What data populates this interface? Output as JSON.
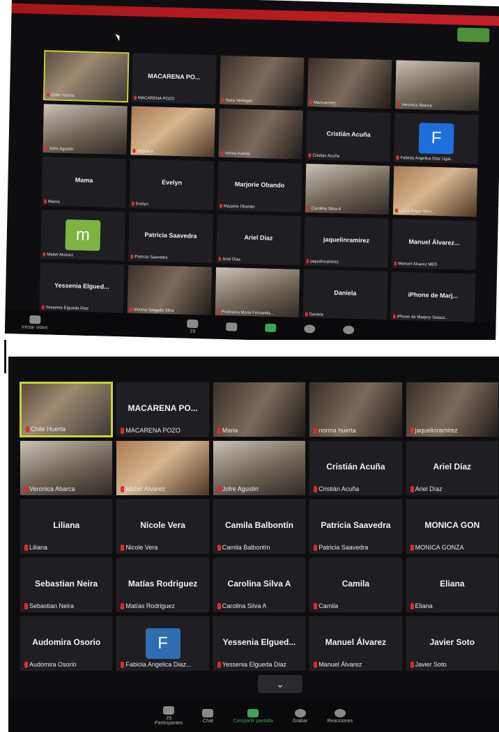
{
  "top_photo": {
    "tiles": [
      {
        "display": "",
        "tag": "Chile Huerta",
        "video": true,
        "style": "v1",
        "active": true
      },
      {
        "display": "MACARENA PO...",
        "tag": "MACARENA POZO",
        "video": false
      },
      {
        "display": "",
        "tag": "Nora Venegas",
        "video": true,
        "style": "v3"
      },
      {
        "display": "",
        "tag": "Maricarmen",
        "video": true,
        "style": "v3"
      },
      {
        "display": "",
        "tag": "Veronica Abarca",
        "video": true,
        "style": "v2"
      },
      {
        "display": "",
        "tag": "Jofre Agustin",
        "video": true,
        "style": "v2"
      },
      {
        "display": "",
        "tag": "Angelica",
        "video": true,
        "style": "v4"
      },
      {
        "display": "",
        "tag": "norma huerta",
        "video": true,
        "style": "v3"
      },
      {
        "display": "Cristián Acuña",
        "tag": "Cristián Acuña",
        "video": false
      },
      {
        "display": "",
        "tag": "Fabiola Angelica Diaz Ugal...",
        "video": false,
        "avatar": "F",
        "avatar_color": "#1e6fd9"
      },
      {
        "display": "Mama",
        "tag": "Mama",
        "video": false
      },
      {
        "display": "Evelyn",
        "tag": "Evelyn",
        "video": false
      },
      {
        "display": "Marjorie Obando",
        "tag": "Marjorie Obando",
        "video": false
      },
      {
        "display": "",
        "tag": "Carolina Silva A",
        "video": true,
        "style": "v2"
      },
      {
        "display": "",
        "tag": "Liana Rojas Silva",
        "video": true,
        "style": "v4"
      },
      {
        "display": "",
        "tag": "Mabel Alvarez",
        "video": false,
        "avatar": "m",
        "avatar_color": "#7cb342"
      },
      {
        "display": "Patricia Saavedra",
        "tag": "Patricia Saavedra",
        "video": false
      },
      {
        "display": "Ariel Diaz",
        "tag": "Ariel Diaz",
        "video": false
      },
      {
        "display": "jaquelinramirez",
        "tag": "jaquelinramirez",
        "video": false
      },
      {
        "display": "Manuel Álvarez...",
        "tag": "Manuel Álvarez MED",
        "video": false
      },
      {
        "display": "Yessenia Elgued...",
        "tag": "Yessenia Elgueda Diaz",
        "video": false
      },
      {
        "display": "",
        "tag": "Viviana Salgado Silva",
        "video": true,
        "style": "v3"
      },
      {
        "display": "",
        "tag": "Profesora Maria Fernanda...",
        "video": true,
        "style": "v2"
      },
      {
        "display": "Daniela",
        "tag": "Daniela",
        "video": false
      },
      {
        "display": "iPhone de Marj...",
        "tag": "iPhone de Marjory Salaza...",
        "video": false
      }
    ],
    "toolbar": {
      "start_video": "Iniciar video",
      "participants_count": "29",
      "labels": [
        "Participantes",
        "Chat",
        "Compartir pantalla",
        "Grabar",
        "Reacciones"
      ]
    }
  },
  "bottom_photo": {
    "tiles": [
      {
        "display": "",
        "tag": "Chile Huerta",
        "video": true,
        "style": "v1",
        "active": true
      },
      {
        "display": "MACARENA PO...",
        "tag": "MACARENA POZO",
        "video": false
      },
      {
        "display": "",
        "tag": "Maria",
        "video": true,
        "style": "v3"
      },
      {
        "display": "",
        "tag": "norma huerta",
        "video": true,
        "style": "v3"
      },
      {
        "display": "",
        "tag": "jaquelinramirez",
        "video": true,
        "style": "v3"
      },
      {
        "display": "",
        "tag": "Veronica Abarca",
        "video": true,
        "style": "v2"
      },
      {
        "display": "",
        "tag": "Mabel Alvarez",
        "video": true,
        "style": "v4"
      },
      {
        "display": "",
        "tag": "Jofre Agustin",
        "video": true,
        "style": "v2"
      },
      {
        "display": "Cristián Acuña",
        "tag": "Cristián Acuña",
        "video": false
      },
      {
        "display": "Ariel Díaz",
        "tag": "Ariel Díaz",
        "video": false
      },
      {
        "display": "Liliana",
        "tag": "Liliana",
        "video": false
      },
      {
        "display": "Nicole Vera",
        "tag": "Nicole Vera",
        "video": false
      },
      {
        "display": "Camila Balbontín",
        "tag": "Camila Balbontín",
        "video": false
      },
      {
        "display": "Patricia Saavedra",
        "tag": "Patricia Saavedra",
        "video": false
      },
      {
        "display": "MONICA GON",
        "tag": "MONICA GONZA",
        "video": false
      },
      {
        "display": "Sebastian Neira",
        "tag": "Sebastian Neira",
        "video": false
      },
      {
        "display": "Matías Rodriguez",
        "tag": "Matías Rodriguez",
        "video": false
      },
      {
        "display": "Carolina Silva A",
        "tag": "Carolina Silva A",
        "video": false
      },
      {
        "display": "Camila",
        "tag": "Camila",
        "video": false
      },
      {
        "display": "Eliana",
        "tag": "Eliana",
        "video": false
      },
      {
        "display": "Audomira Osorio",
        "tag": "Audomira Osorio",
        "video": false
      },
      {
        "display": "",
        "tag": "Fabiola Angelica Diaz...",
        "video": false,
        "avatar": "F",
        "avatar_color": "#2f6db0"
      },
      {
        "display": "Yessenia Elgued...",
        "tag": "Yessenia Elgueda Diaz",
        "video": false
      },
      {
        "display": "Manuel Álvarez",
        "tag": "Manuel Álvarez",
        "video": false
      },
      {
        "display": "Javier Soto",
        "tag": "Javier Soto",
        "video": false
      }
    ],
    "toolbar": {
      "participants_count": "29",
      "labels": [
        "Participantes",
        "Chat",
        "Compartir pantalla",
        "Grabar",
        "Reacciones"
      ]
    },
    "more_chevron": "⌄"
  }
}
